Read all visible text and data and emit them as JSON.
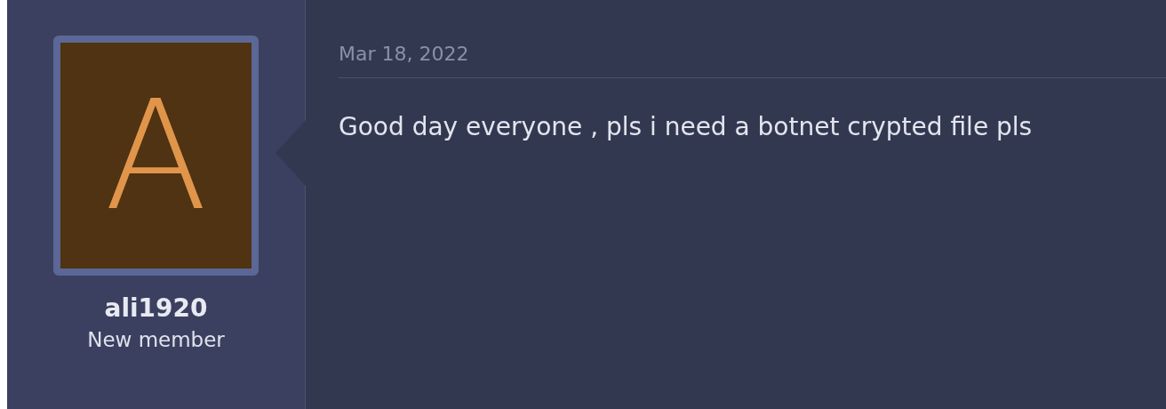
{
  "post": {
    "author": {
      "avatar_letter": "A",
      "name": "ali1920",
      "title": "New member"
    },
    "date": "Mar 18, 2022",
    "message": "Good day everyone , pls i need a botnet crypted file pls"
  }
}
